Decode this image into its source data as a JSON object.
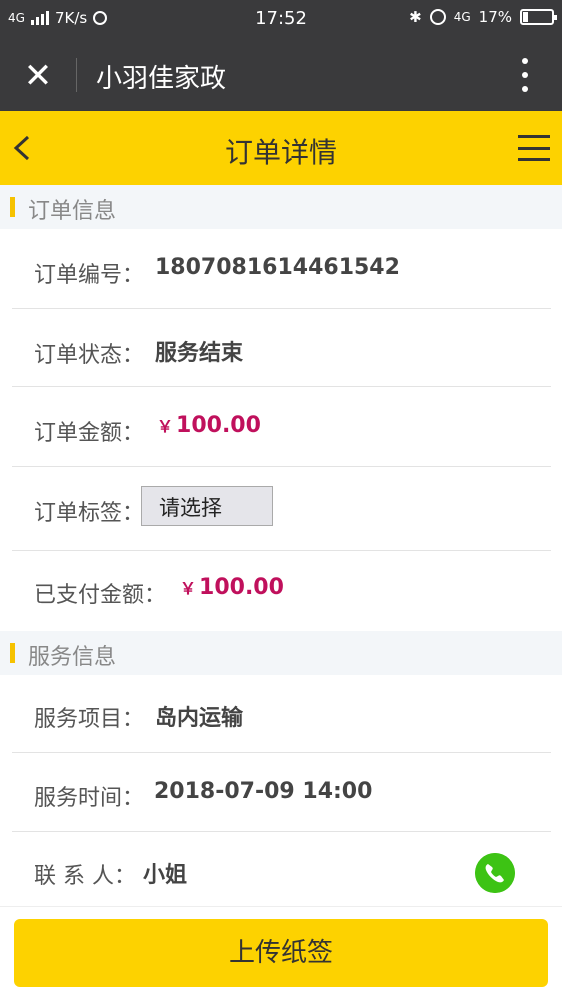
{
  "status_bar": {
    "network": "4G",
    "speed": "7K/s",
    "time": "17:52",
    "net_right": "4G",
    "battery_level": 0.17,
    "battery_text": "17%"
  },
  "app_header": {
    "title": "小羽佳家政",
    "close_icon": "close-icon",
    "more_icon": "more-vertical-icon"
  },
  "page_header": {
    "title": "订单详情",
    "back_icon": "chevron-left-icon",
    "menu_icon": "hamburger-menu-icon",
    "accent_color": "#fdd200"
  },
  "order_section": {
    "title": "订单信息",
    "rows": [
      {
        "label": "订单编号：",
        "value": "1807081614461542"
      },
      {
        "label": "订单状态：",
        "value": "服务结束"
      },
      {
        "label": "订单金额：",
        "currency": "￥",
        "value": "100.00"
      },
      {
        "label": "订单标签：",
        "select_value": "请选择"
      },
      {
        "label": "已支付金额：",
        "currency": "￥",
        "value": "100.00"
      }
    ]
  },
  "service_section": {
    "title": "服务信息",
    "rows": [
      {
        "label": "服务项目：",
        "value": "岛内运输"
      },
      {
        "label": "服务时间：",
        "value": "2018-07-09 14:00"
      },
      {
        "label": "联 系 人：",
        "value": "小姐"
      }
    ],
    "phone_icon": "phone-icon",
    "phone_color": "#3dc314"
  },
  "footer": {
    "upload_label": "上传纸签"
  },
  "colors": {
    "money": "#c0105c",
    "header_dark": "#3a3a3c"
  }
}
